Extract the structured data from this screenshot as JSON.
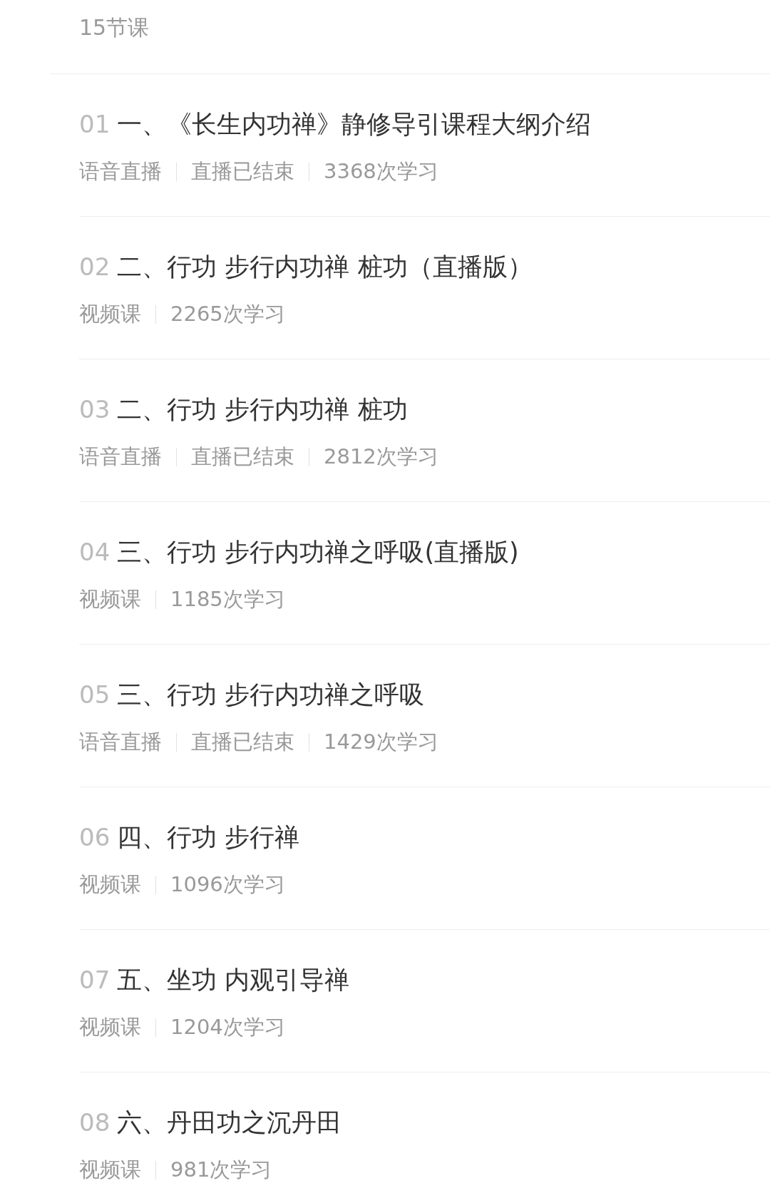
{
  "lesson_count": "15节课",
  "lessons": [
    {
      "number": "01",
      "title": "一、《长生内功禅》静修导引课程大纲介绍",
      "meta": [
        "语音直播",
        "直播已结束",
        "3368次学习"
      ]
    },
    {
      "number": "02",
      "title": "二、行功 步行内功禅 桩功（直播版）",
      "meta": [
        "视频课",
        "2265次学习"
      ]
    },
    {
      "number": "03",
      "title": "二、行功 步行内功禅 桩功",
      "meta": [
        "语音直播",
        "直播已结束",
        "2812次学习"
      ]
    },
    {
      "number": "04",
      "title": "三、行功 步行内功禅之呼吸(直播版)",
      "meta": [
        "视频课",
        "1185次学习"
      ]
    },
    {
      "number": "05",
      "title": "三、行功 步行内功禅之呼吸",
      "meta": [
        "语音直播",
        "直播已结束",
        "1429次学习"
      ]
    },
    {
      "number": "06",
      "title": "四、行功 步行禅",
      "meta": [
        "视频课",
        "1096次学习"
      ]
    },
    {
      "number": "07",
      "title": "五、坐功 内观引导禅",
      "meta": [
        "视频课",
        "1204次学习"
      ]
    },
    {
      "number": "08",
      "title": "六、丹田功之沉丹田",
      "meta": [
        "视频课",
        "981次学习"
      ]
    }
  ]
}
